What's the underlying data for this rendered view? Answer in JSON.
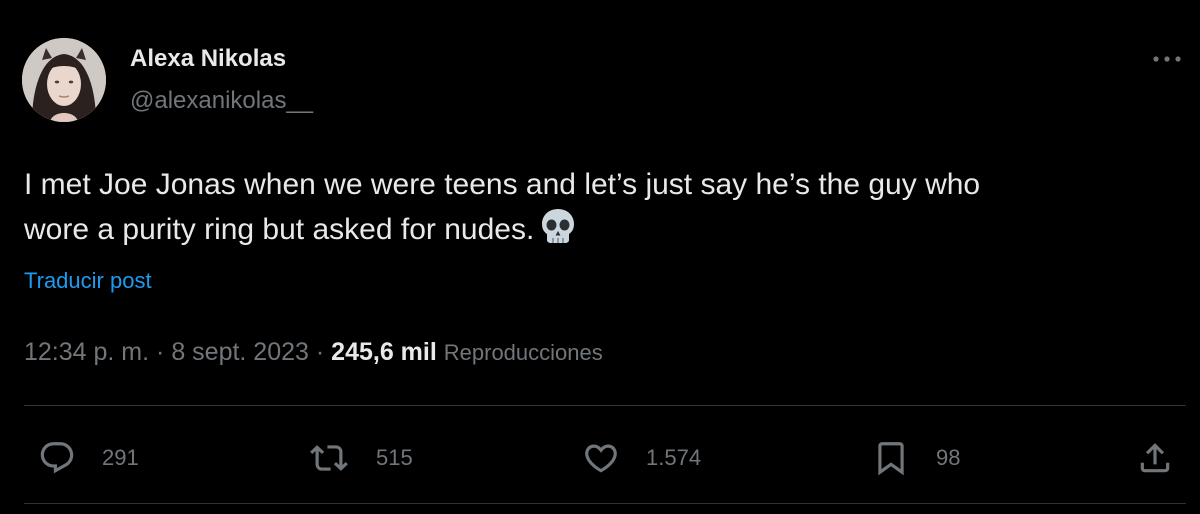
{
  "author": {
    "name": "Alexa Nikolas",
    "handle": "@alexanikolas__",
    "avatar_icon": "profile-photo"
  },
  "tweet": {
    "line1": "I met Joe Jonas when we were teens and let’s just say he’s the guy who",
    "line2": "wore a purity ring but asked for nudes.",
    "emoji": "skull-emoji"
  },
  "translate_label": "Traducir post",
  "meta": {
    "time": "12:34 p. m.",
    "separator": "·",
    "date": "8 sept. 2023",
    "views_count": "245,6 mil",
    "views_label": "Reproducciones"
  },
  "actions": {
    "replies": "291",
    "reposts": "515",
    "likes": "1.574",
    "bookmarks": "98"
  },
  "colors": {
    "background": "#000000",
    "text_primary": "#e7e9ea",
    "text_secondary": "#71767b",
    "accent": "#1d9bf0",
    "divider": "#2f3336"
  }
}
